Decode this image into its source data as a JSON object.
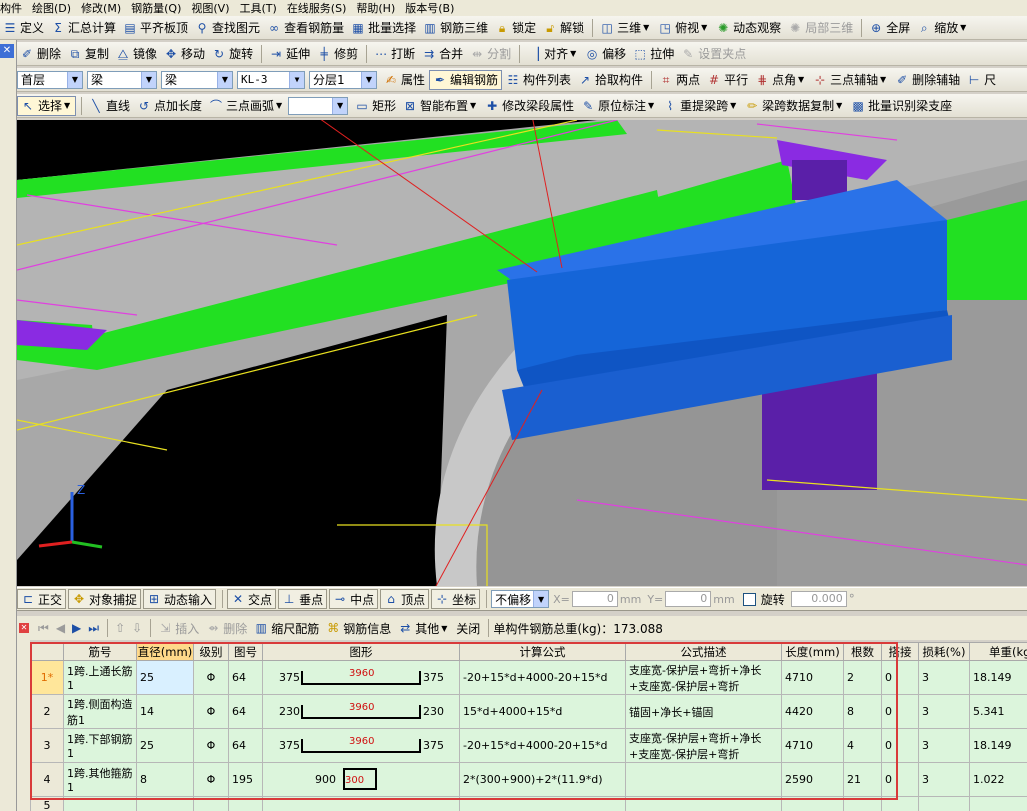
{
  "menubar": [
    "构件",
    "绘图(D)",
    "修改(M)",
    "钢筋量(Q)",
    "视图(V)",
    "工具(T)",
    "在线服务(S)",
    "帮助(H)",
    "版本号(B)"
  ],
  "toolbar1": {
    "items": [
      "定义",
      "汇总计算",
      "平齐板顶",
      "查找图元",
      "查看钢筋量",
      "批量选择",
      "钢筋三维",
      "锁定",
      "解锁",
      "三维",
      "俯视",
      "动态观察",
      "局部三维",
      "全屏",
      "缩放"
    ]
  },
  "toolbar2": {
    "items": [
      "删除",
      "复制",
      "镜像",
      "移动",
      "旋转",
      "延伸",
      "修剪",
      "打断",
      "合并",
      "分割",
      "对齐",
      "偏移",
      "拉伸",
      "设置夹点"
    ]
  },
  "toolbar3": {
    "floor": "首层",
    "type1": "梁",
    "type2": "梁",
    "element": "KL-3",
    "layer": "分层1",
    "items": [
      "属性",
      "编辑钢筋",
      "构件列表",
      "拾取构件",
      "两点",
      "平行",
      "点角",
      "三点辅轴",
      "删除辅轴",
      "尺"
    ]
  },
  "toolbar4": {
    "select": "选择",
    "items": [
      "直线",
      "点加长度",
      "三点画弧",
      "矩形",
      "智能布置",
      "修改梁段属性",
      "原位标注",
      "重提梁跨",
      "梁跨数据复制",
      "批量识别梁支座"
    ]
  },
  "statusbar": {
    "items": [
      "正交",
      "对象捕捉",
      "动态输入",
      "交点",
      "垂点",
      "中点",
      "顶点",
      "坐标"
    ],
    "offset_mode": "不偏移",
    "x_label": "X=",
    "x_value": "0",
    "y_label": "Y=",
    "y_value": "0",
    "unit": "mm",
    "rotate_label": "旋转",
    "rotate_value": "0.000",
    "degree": "°"
  },
  "rebar_toolbar": {
    "items": [
      "插入",
      "删除",
      "缩尺配筋",
      "钢筋信息",
      "其他",
      "关闭"
    ],
    "total_weight": "单构件钢筋总重(kg)：173.088"
  },
  "grid": {
    "headers": [
      "筋号",
      "直径(mm)",
      "级别",
      "图号",
      "图形",
      "计算公式",
      "公式描述",
      "长度(mm)",
      "根数",
      "搭接",
      "损耗(%)",
      "单重(kg)"
    ],
    "rows": [
      {
        "no": "1*",
        "name": "1跨.上通长筋1",
        "dia": "25",
        "grade": "Φ",
        "fig": "64",
        "left": "375",
        "mid": "3960",
        "right": "375",
        "formula": "-20+15*d+4000-20+15*d",
        "desc": "支座宽-保护层+弯折+净长+支座宽-保护层+弯折",
        "len": "4710",
        "count": "2",
        "lap": "0",
        "loss": "3",
        "weight": "18.149"
      },
      {
        "no": "2",
        "name": "1跨.侧面构造筋1",
        "dia": "14",
        "grade": "Φ",
        "fig": "64",
        "left": "230",
        "mid": "3960",
        "right": "230",
        "formula": "15*d+4000+15*d",
        "desc": "锚固+净长+锚固",
        "len": "4420",
        "count": "8",
        "lap": "0",
        "loss": "3",
        "weight": "5.341"
      },
      {
        "no": "3",
        "name": "1跨.下部钢筋1",
        "dia": "25",
        "grade": "Φ",
        "fig": "64",
        "left": "375",
        "mid": "3960",
        "right": "375",
        "formula": "-20+15*d+4000-20+15*d",
        "desc": "支座宽-保护层+弯折+净长+支座宽-保护层+弯折",
        "len": "4710",
        "count": "4",
        "lap": "0",
        "loss": "3",
        "weight": "18.149"
      },
      {
        "no": "4",
        "name": "1跨.其他箍筋1",
        "dia": "8",
        "grade": "Φ",
        "fig": "195",
        "left": "900",
        "mid": "300",
        "right": "",
        "formula": "2*(300+900)+2*(11.9*d)",
        "desc": "",
        "len": "2590",
        "count": "21",
        "lap": "0",
        "loss": "3",
        "weight": "1.022"
      },
      {
        "no": "5",
        "name": "",
        "dia": "",
        "grade": "",
        "fig": "",
        "left": "",
        "mid": "",
        "right": "",
        "formula": "",
        "desc": "",
        "len": "",
        "count": "",
        "lap": "",
        "loss": "",
        "weight": ""
      }
    ]
  },
  "colors": {
    "beam": "#1565d8",
    "slab": "#b0b0b0",
    "edge": "#22e022",
    "column": "#5a1fa8",
    "grid": "#e040e0",
    "axis": "#e8e020",
    "annotation": "#e02020"
  },
  "axes": {
    "z": "Z"
  }
}
